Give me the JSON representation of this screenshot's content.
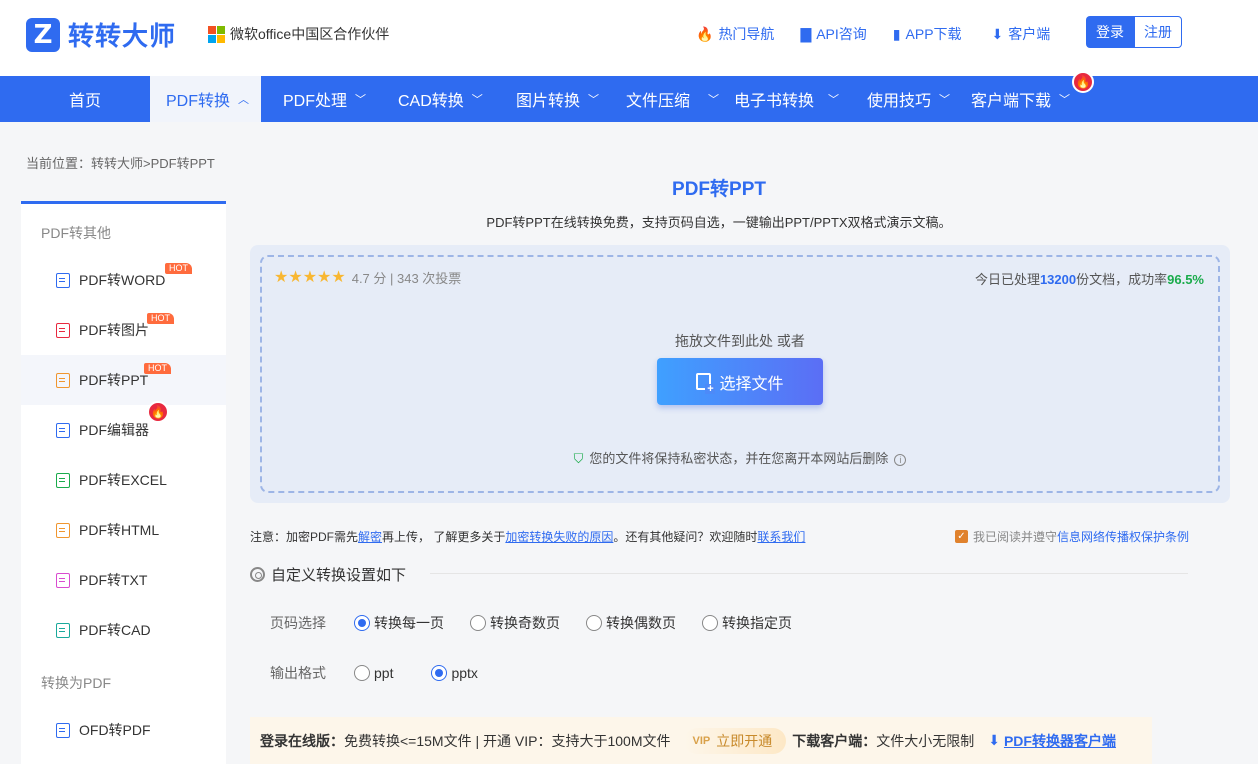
{
  "header": {
    "logo_mark": "Z",
    "logo_text": "转转大师",
    "partner_text": "微软office中国区合作伙伴",
    "links": [
      {
        "icon": "flame-icon",
        "glyph": "🔥",
        "label": "热门导航"
      },
      {
        "icon": "chat-icon",
        "glyph": "▇",
        "label": "API咨询"
      },
      {
        "icon": "phone-icon",
        "glyph": "▮",
        "label": "APP下载"
      },
      {
        "icon": "download-icon",
        "glyph": "⬇",
        "label": "客户端"
      }
    ],
    "login": "登录",
    "register": "注册"
  },
  "nav": {
    "items": [
      "首页",
      "PDF转换",
      "PDF处理",
      "CAD转换",
      "图片转换",
      "文件压缩",
      "电子书转换",
      "使用技巧",
      "客户端下载"
    ],
    "active": "PDF转换"
  },
  "breadcrumb": "当前位置：转转大师>PDF转PPT",
  "sidebar": {
    "group1": "PDF转其他",
    "items": [
      {
        "label": "PDF转WORD",
        "hot": "HOT",
        "color": "#2f6bf0"
      },
      {
        "label": "PDF转图片",
        "hot": "HOT",
        "color": "#e8293f"
      },
      {
        "label": "PDF转PPT",
        "hot": "HOT",
        "color": "#f0962f"
      },
      {
        "label": "PDF编辑器",
        "hot": "",
        "color": "#2f6bf0"
      },
      {
        "label": "PDF转EXCEL",
        "hot": "",
        "color": "#1aab4b"
      },
      {
        "label": "PDF转HTML",
        "hot": "",
        "color": "#f0962f"
      },
      {
        "label": "PDF转TXT",
        "hot": "",
        "color": "#d94bd0"
      },
      {
        "label": "PDF转CAD",
        "hot": "",
        "color": "#1aa99b"
      }
    ],
    "group2": "转换为PDF",
    "items2": [
      {
        "label": "OFD转PDF",
        "color": "#2f6bf0"
      }
    ]
  },
  "main": {
    "title": "PDF转PPT",
    "subtitle": "PDF转PPT在线转换免费，支持页码自选，一键输出PPT/PPTX双格式演示文稿。",
    "stars": "★★★★★",
    "rating": "4.7 分 | 343 次投票",
    "stat_prefix": "今日已处理",
    "stat_num": "13200",
    "stat_mid": "份文档，成功率",
    "stat_pct": "96.5%",
    "drop_hint": "拖放文件到此处 或者",
    "choose_button": "选择文件",
    "privacy": "您的文件将保持私密状态，并在您离开本网站后删除"
  },
  "notice": {
    "t1": "注意：加密PDF需先",
    "l1": "解密",
    "t2": "再上传，  了解更多关于",
    "l2": "加密转换失败的原因",
    "t3": "。还有其他疑问？欢迎随时",
    "l3": "联系我们",
    "agree_text": "我已阅读并遵守",
    "agree_link": "信息网络传播权保护条例"
  },
  "settings": {
    "title": "自定义转换设置如下",
    "page_label": "页码选择",
    "page_options": [
      "转换每一页",
      "转换奇数页",
      "转换偶数页",
      "转换指定页"
    ],
    "page_selected": "转换每一页",
    "format_label": "输出格式",
    "format_options": [
      "ppt",
      "pptx"
    ],
    "format_selected": "pptx"
  },
  "promo": {
    "online_label": "登录在线版：",
    "online_text": "免费转换<=15M文件 | 开通 VIP：支持大于100M文件",
    "vip_button": "立即开通",
    "client_label": "下载客户端：",
    "client_text": "文件大小无限制",
    "client_link": "PDF转换器客户端"
  }
}
